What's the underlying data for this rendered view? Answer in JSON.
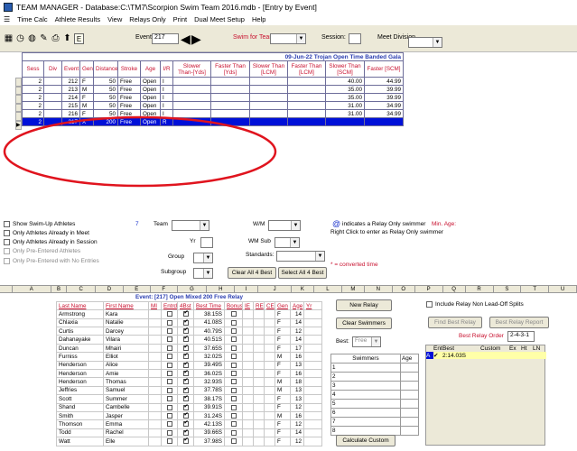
{
  "window": {
    "title": "TEAM MANAGER - Database:C:\\TM7\\Scorpion Swim Team 2016.mdb - [Entry by Event]"
  },
  "menu": [
    "Time Calc",
    "Athlete Results",
    "View",
    "Relays Only",
    "Print",
    "Dual Meet Setup",
    "Help"
  ],
  "toolbar": {
    "event_label": "Event",
    "event_value": "217",
    "swim_for_team_label": "Swim for Team:",
    "session_label": "Session:",
    "meet_division_label": "Meet Division"
  },
  "meet": {
    "header": "09-Jun-22  Trojan Open Time Banded Gala"
  },
  "event_columns": [
    "Sess",
    "Div",
    "Event",
    "Gen",
    "Distance",
    "Stroke",
    "Age",
    "I/R",
    "Slower Than-[Yds]",
    "Faster Than [Yds]",
    "Slower Than [LCM]",
    "Faster Than [LCM]",
    "Slower Than [SCM]",
    "Faster [SCM]"
  ],
  "event_rows": [
    [
      "2",
      "",
      "212",
      "F",
      "50",
      "Free",
      "Open",
      "I",
      "",
      "",
      "",
      "",
      "40.00",
      "44.99"
    ],
    [
      "2",
      "",
      "213",
      "M",
      "50",
      "Free",
      "Open",
      "I",
      "",
      "",
      "",
      "",
      "35.00",
      "39.99"
    ],
    [
      "2",
      "",
      "214",
      "F",
      "50",
      "Free",
      "Open",
      "I",
      "",
      "",
      "",
      "",
      "35.00",
      "39.99"
    ],
    [
      "2",
      "",
      "215",
      "M",
      "50",
      "Free",
      "Open",
      "I",
      "",
      "",
      "",
      "",
      "31.00",
      "34.99"
    ],
    [
      "2",
      "",
      "216",
      "F",
      "50",
      "Free",
      "Open",
      "I",
      "",
      "",
      "",
      "",
      "31.00",
      "34.99"
    ],
    [
      "2",
      "",
      "217",
      "X",
      "200",
      "Free",
      "Open",
      "R",
      "",
      "",
      "",
      "",
      "",
      ""
    ]
  ],
  "options": {
    "show_swim_up": "Show Swim-Up Athletes",
    "only_in_meet": "Only Athletes Already in Meet",
    "only_in_session": "Only Athletes Already in Session",
    "only_pre_entered": "Only Pre-Entered Athletes",
    "only_pre_no_entries": "Only Pre-Entered with No Entries",
    "count": "7",
    "team_label": "Team",
    "yr_label": "Yr",
    "group_label": "Group",
    "subgroup_label": "Subgroup",
    "wm_label": "W/M",
    "wmsub_label": "WM Sub",
    "standards_label": "Standards:",
    "clear_all_best": "Clear All 4 Best",
    "select_all_best": "Select All 4 Best",
    "relay_note_symbol": "@",
    "relay_note": "indicates a Relay Only swimmer",
    "min_age": "Min. Age:",
    "right_click_note": "Right Click to enter as Relay Only swimmer",
    "converted_note": "* = converted time"
  },
  "sheet_cols": [
    "A",
    "B",
    "C",
    "D",
    "E",
    "F",
    "G",
    "H",
    "I",
    "J",
    "K",
    "L",
    "M",
    "N",
    "O",
    "P",
    "Q",
    "R",
    "S",
    "T",
    "U"
  ],
  "athletes": {
    "event_header": "Event: [217]  Open  Mixed  200  Free Relay",
    "columns": [
      "Last Name",
      "First Name",
      "MI",
      "Entrd",
      "4Bst",
      "Best Time",
      "Bonus",
      "IE",
      "RE",
      "CE",
      "Gen",
      "Age",
      "Yr"
    ],
    "rows": [
      [
        "Armstrong",
        "Kara",
        "",
        false,
        true,
        "38.15S",
        false,
        "",
        "",
        "",
        "F",
        "14",
        ""
      ],
      [
        "Chlaxia",
        "Natalie",
        "",
        false,
        true,
        "41.08S",
        false,
        "",
        "",
        "",
        "F",
        "14",
        ""
      ],
      [
        "Curtis",
        "Darcey",
        "",
        false,
        true,
        "40.79S",
        false,
        "",
        "",
        "",
        "F",
        "12",
        ""
      ],
      [
        "Dahanayake",
        "Vilara",
        "",
        false,
        true,
        "40.51S",
        false,
        "",
        "",
        "",
        "F",
        "14",
        ""
      ],
      [
        "Duncan",
        "Mhairi",
        "",
        false,
        true,
        "37.65S",
        false,
        "",
        "",
        "",
        "F",
        "17",
        ""
      ],
      [
        "Furniss",
        "Elliot",
        "",
        false,
        true,
        "32.02S",
        false,
        "",
        "",
        "",
        "M",
        "16",
        ""
      ],
      [
        "Henderson",
        "Alice",
        "",
        false,
        true,
        "39.49S",
        false,
        "",
        "",
        "",
        "F",
        "13",
        ""
      ],
      [
        "Henderson",
        "Amie",
        "",
        false,
        true,
        "36.02S",
        false,
        "",
        "",
        "",
        "F",
        "16",
        ""
      ],
      [
        "Henderson",
        "Thomas",
        "",
        false,
        true,
        "32.93S",
        false,
        "",
        "",
        "",
        "M",
        "18",
        ""
      ],
      [
        "Jeffries",
        "Samuel",
        "",
        false,
        true,
        "37.78S",
        false,
        "",
        "",
        "",
        "M",
        "13",
        ""
      ],
      [
        "Scott",
        "Summer",
        "",
        false,
        true,
        "38.17S",
        false,
        "",
        "",
        "",
        "F",
        "13",
        ""
      ],
      [
        "Shand",
        "Cambelle",
        "",
        false,
        true,
        "39.91S",
        false,
        "",
        "",
        "",
        "F",
        "12",
        ""
      ],
      [
        "Smith",
        "Jasper",
        "",
        false,
        true,
        "31.24S",
        false,
        "",
        "",
        "",
        "M",
        "16",
        ""
      ],
      [
        "Thomson",
        "Emma",
        "",
        false,
        true,
        "42.13S",
        false,
        "",
        "",
        "",
        "F",
        "12",
        ""
      ],
      [
        "Todd",
        "Rachel",
        "",
        false,
        true,
        "39.66S",
        false,
        "",
        "",
        "",
        "F",
        "14",
        ""
      ],
      [
        "Watt",
        "Elle",
        "",
        false,
        true,
        "37.98S",
        false,
        "",
        "",
        "",
        "F",
        "12",
        ""
      ]
    ]
  },
  "relay": {
    "new_relay": "New Relay",
    "clear_swimmers": "Clear Swimmers",
    "best_label": "Best:",
    "best_value": "Free",
    "swimmers_header": "Swimmers",
    "age_header": "Age",
    "positions": [
      "1",
      "2",
      "3",
      "4",
      "5",
      "6",
      "7",
      "8"
    ],
    "calculate_custom": "Calculate Custom",
    "include_non_leadoff": "Include Relay Non Lead-Off Splits",
    "find_best_relay": "Find Best Relay",
    "best_relay_report": "Best Relay Report",
    "best_relay_order_label": "Best Relay Order",
    "best_relay_order_value": "2-4-3-1",
    "best_columns": [
      "",
      "Ent",
      "Best",
      "Custom",
      "Ex",
      "Ht",
      "LN"
    ],
    "best_row": [
      "A",
      "✔",
      "2:14.03S",
      "",
      "",
      "",
      ""
    ]
  },
  "colors": {
    "selected_row": "#0010d8",
    "header_red": "#c8102e",
    "link_blue": "#1a33cc",
    "annotation": "#e0141e"
  }
}
